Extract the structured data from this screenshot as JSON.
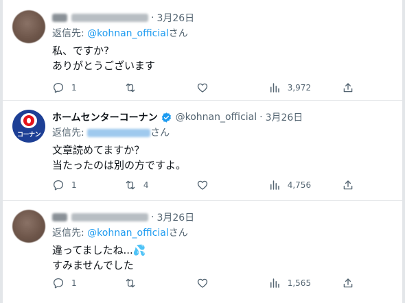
{
  "tweets": [
    {
      "date": "3月26日",
      "reply_prefix": "返信先: ",
      "reply_mention": "@kohnan_official",
      "reply_suffix": "さん",
      "lines": [
        "私、ですか?",
        "ありがとうございます"
      ],
      "replies": "1",
      "retweets": "",
      "views": "3,972"
    },
    {
      "display_name": "ホームセンターコーナン",
      "handle": "@kohnan_official",
      "date": "3月26日",
      "reply_prefix": "返信先: ",
      "reply_suffix": "さん",
      "lines": [
        "文章読めてますか？",
        "当たったのは別の方ですよ。"
      ],
      "replies": "1",
      "retweets": "4",
      "views": "4,756",
      "avatar_logo_text": "コーナン"
    },
    {
      "date": "3月26日",
      "reply_prefix": "返信先: ",
      "reply_mention": "@kohnan_official",
      "reply_suffix": "さん",
      "lines": [
        "違ってましたね...💦",
        "すみませんでした"
      ],
      "replies": "1",
      "retweets": "",
      "views": "1,565"
    }
  ],
  "separator": "·",
  "colors": {
    "accent": "#1d9bf0",
    "secondary_text": "#536471",
    "primary_text": "#0f1419",
    "kohnan_blue": "#1d3f95",
    "kohnan_red": "#e5141b"
  },
  "icons": [
    "reply-icon",
    "retweet-icon",
    "like-icon",
    "views-icon",
    "share-icon",
    "verified-badge-icon"
  ]
}
